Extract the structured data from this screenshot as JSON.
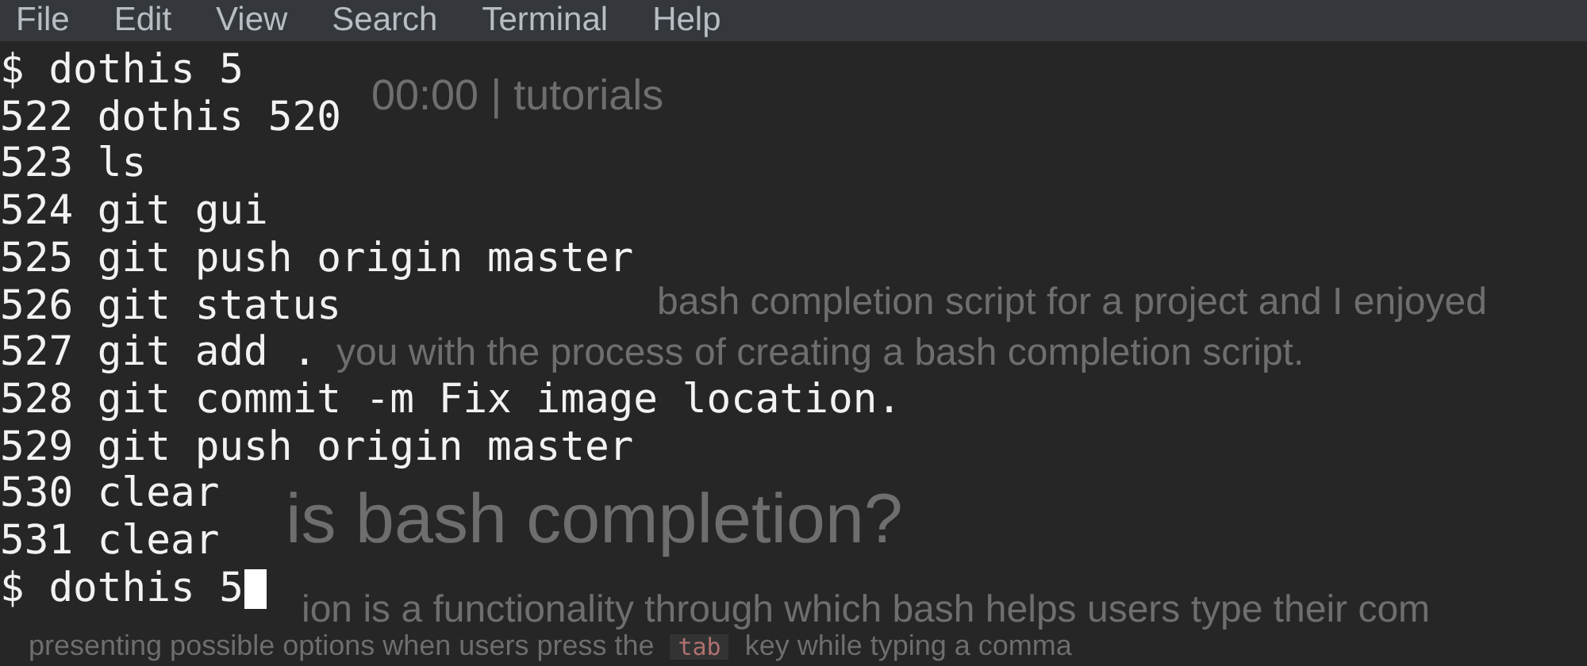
{
  "menu": [
    "File",
    "Edit",
    "View",
    "Search",
    "Terminal",
    "Help"
  ],
  "background_page": {
    "lines": [
      {
        "kind": "meta",
        "text": "00:00 | tutorials"
      },
      {
        "kind": "body",
        "text": "bash completion script for a project and I enjoyed"
      },
      {
        "kind": "body",
        "text": "you with the process of creating a bash completion script."
      },
      {
        "kind": "heading",
        "text": "is bash completion?"
      },
      {
        "kind": "body",
        "text": "ion is a functionality through which bash helps users type their com"
      },
      {
        "kind": "mixed",
        "segments": [
          {
            "text": "presenting possible options when users press the",
            "code": false
          },
          {
            "text": "tab",
            "code": true
          },
          {
            "text": "key while typing a comma",
            "code": false
          }
        ]
      }
    ]
  },
  "terminal": {
    "lines": [
      "$ dothis 5",
      "522 dothis 520",
      "523 ls",
      "524 git gui",
      "525 git push origin master",
      "526 git status",
      "527 git add .",
      "528 git commit -m Fix image location.",
      "529 git push origin master",
      "530 clear",
      "531 clear"
    ],
    "prompt": {
      "text": "$ dothis 5",
      "cursor": true
    }
  }
}
